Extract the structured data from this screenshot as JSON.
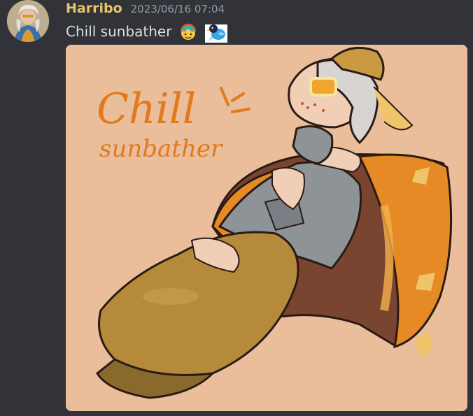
{
  "message": {
    "username": "Harribo",
    "timestamp": "2023/06/16 07:04",
    "text": "Chill sunbather",
    "emojis": [
      "rainbow-face-emoji",
      "blue-bird-emoji"
    ]
  },
  "attachment": {
    "title_line1": "Chill",
    "title_line2": "sunbather",
    "background_color": "#eabd9b"
  },
  "colors": {
    "app_background": "#313338",
    "username": "#e8c56b",
    "timestamp": "#949ba4",
    "message_text": "#dbdee1"
  }
}
